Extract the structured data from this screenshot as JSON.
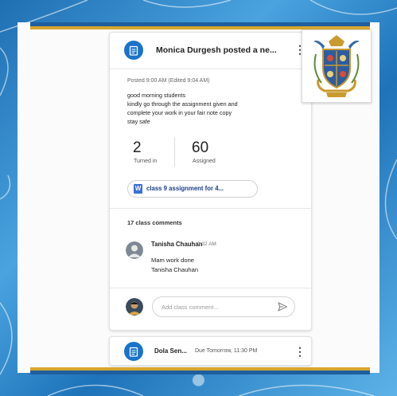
{
  "post": {
    "author_line": "Monica Durgesh posted a ne...",
    "posted": "Posted 9:00 AM (Edited 9:04 AM)",
    "message_lines": [
      "good morning students",
      "kindly go through the assignment given and",
      "complete your work in your fair note copy",
      "stay safe"
    ],
    "turned_in_count": "2",
    "turned_in_label": "Turned in",
    "assigned_count": "60",
    "assigned_label": "Assigned",
    "attachment_icon_letter": "W",
    "attachment": "class 9 assignment for 4..."
  },
  "comments": {
    "heading": "17 class comments",
    "items": [
      {
        "name": "Tanisha Chauhan",
        "time": "9:32 AM",
        "text_lines": [
          "Mam work done",
          "Tanisha Chauhan"
        ]
      }
    ],
    "input_placeholder": "Add class comment..."
  },
  "next_post": {
    "title": "Dola Sen...",
    "meta": "Due Tomorrow, 11:30 PM"
  },
  "colors": {
    "frame_blue": "#2f86c6",
    "gold": "#d7a62e",
    "accent": "#1a73c9"
  },
  "icons": {
    "post_icon": "assignment-icon",
    "more": "more-vert-icon",
    "send": "send-icon",
    "attachment": "word-doc-icon"
  }
}
